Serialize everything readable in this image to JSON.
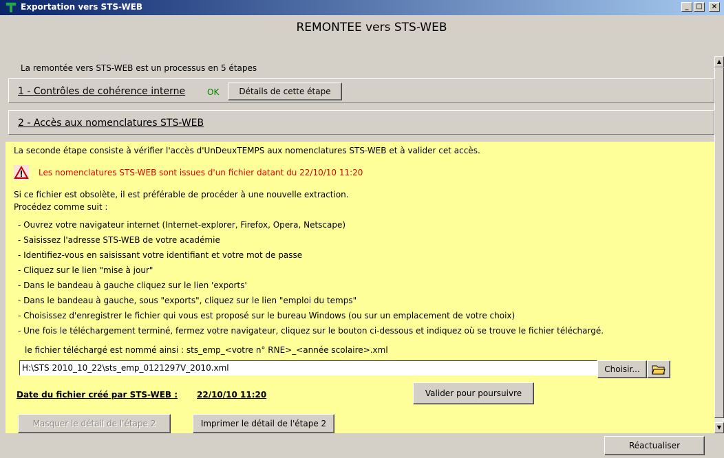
{
  "window": {
    "title": "Exportation vers STS-WEB",
    "minimize": "_",
    "maximize": "□",
    "close": "×"
  },
  "main_title": "REMONTEE vers STS-WEB",
  "intro": "La remontée vers STS-WEB est un processus en 5 étapes",
  "step1": {
    "label": "1 - Contrôles de cohérence interne",
    "status": "OK",
    "details_button": "Détails de cette étape"
  },
  "step2": {
    "label": "2 - Accès aux nomenclatures STS-WEB"
  },
  "content": {
    "line1": "La seconde étape consiste à vérifier l'accès d'UnDeuxTEMPS aux nomenclatures STS-WEB et à valider cet accès.",
    "warning": "Les nomenclatures STS-WEB sont issues d'un fichier datant du 22/10/10  11:20",
    "line3": "Si ce fichier est obsolète, il est préférable de procéder à une nouvelle extraction.",
    "line4": "Procédez comme suit :",
    "steps": [
      "- Ouvrez votre navigateur internet (Internet-explorer, Firefox, Opera, Netscape)",
      "- Saisissez l'adresse STS-WEB de votre académie",
      "- Identifiez-vous en saisissant votre identifiant et votre mot de passe",
      "- Cliquez sur le lien \"mise à jour\"",
      "- Dans le bandeau à gauche cliquez sur le lien 'exports'",
      "- Dans le bandeau à gauche, sous \"exports\", cliquez sur le lien \"emploi du temps\"",
      "- Choisissez d'enregistrer le fichier qui vous est proposé sur le bureau Windows (ou sur un emplacement de votre choix)",
      "- Une fois le téléchargement terminé, fermez votre navigateur, cliquez sur le bouton ci-dessous et indiquez où se trouve le fichier téléchargé."
    ],
    "filename_hint": "le fichier téléchargé est  nommé ainsi : sts_emp_<votre n° RNE>_<année scolaire>.xml",
    "path_value": "H:\\STS 2010_10_22\\sts_emp_0121297V_2010.xml",
    "choose_button": "Choisir...",
    "date_label": "Date du fichier créé par STS-WEB :",
    "date_value": "22/10/10  11:20",
    "validate_button": "Valider pour poursuivre",
    "hide_button": "Masquer le détail de l'étape 2",
    "print_button": "Imprimer le détail de l'étape 2"
  },
  "refresh_button": "Réactualiser"
}
